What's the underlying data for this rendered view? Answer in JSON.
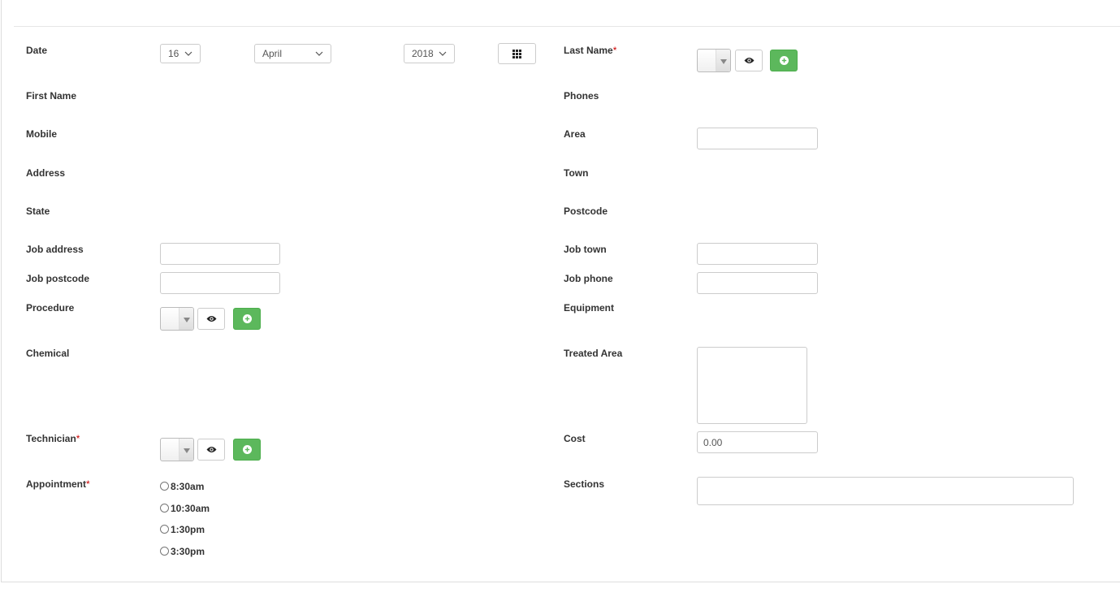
{
  "labels": {
    "date": "Date",
    "last_name": "Last Name",
    "first_name": "First Name",
    "phones": "Phones",
    "mobile": "Mobile",
    "area": "Area",
    "address": "Address",
    "town": "Town",
    "state": "State",
    "postcode": "Postcode",
    "job_address": "Job address",
    "job_town": "Job town",
    "job_postcode": "Job postcode",
    "job_phone": "Job phone",
    "procedure": "Procedure",
    "equipment": "Equipment",
    "chemical": "Chemical",
    "treated_area": "Treated Area",
    "technician": "Technician",
    "cost": "Cost",
    "appointment": "Appointment",
    "sections": "Sections",
    "required_mark": "*"
  },
  "date": {
    "day": "16",
    "month": "April",
    "year": "2018"
  },
  "fields": {
    "area": "",
    "job_address": "",
    "job_town": "",
    "job_postcode": "",
    "job_phone": "",
    "treated_area": "",
    "cost": "0.00",
    "sections": ""
  },
  "appointment_options": [
    "8:30am",
    "10:30am",
    "1:30pm",
    "3:30pm"
  ],
  "icons": {
    "calendar": "calendar-grid-icon",
    "view": "eye-icon",
    "add": "plus-circle-icon"
  },
  "colors": {
    "add_button": "#5cb85c",
    "required": "#cc0000"
  }
}
